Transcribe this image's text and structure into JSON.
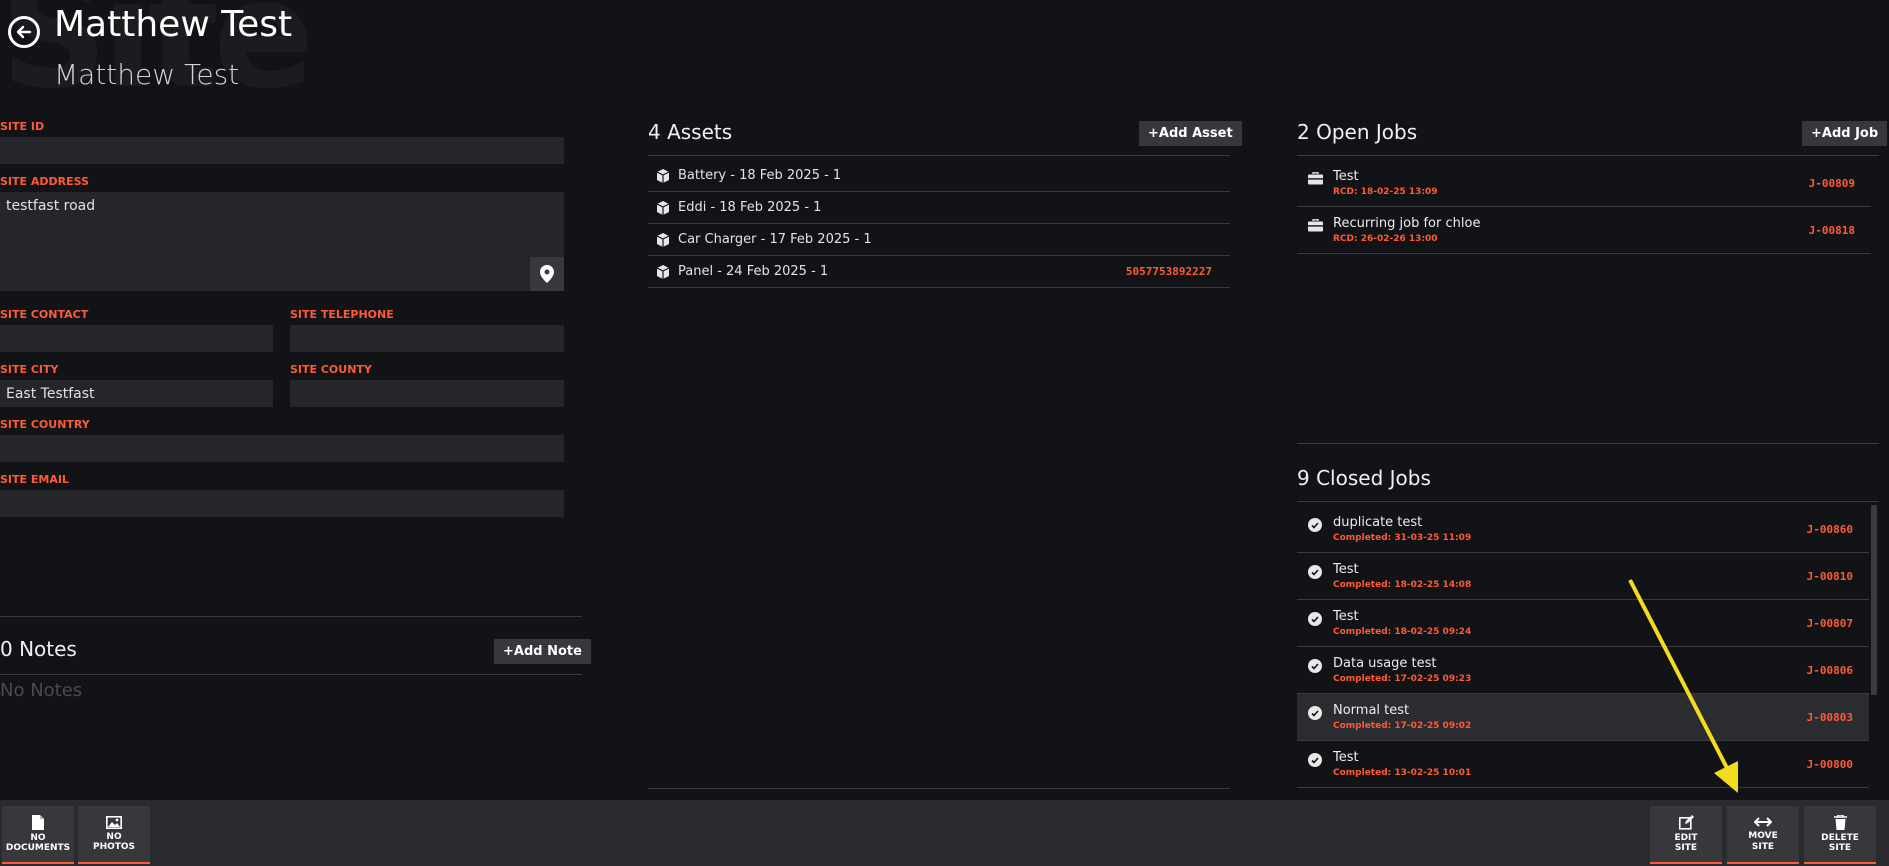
{
  "header": {
    "title": "Matthew Test",
    "subtitle": "Matthew Test",
    "watermark": "Site"
  },
  "form": {
    "site_id": {
      "label": "SITE ID",
      "value": ""
    },
    "site_address": {
      "label": "SITE ADDRESS",
      "value": "testfast road"
    },
    "site_contact": {
      "label": "SITE CONTACT",
      "value": ""
    },
    "site_telephone": {
      "label": "SITE TELEPHONE",
      "value": ""
    },
    "site_city": {
      "label": "SITE CITY",
      "value": "East Testfast"
    },
    "site_county": {
      "label": "SITE COUNTY",
      "value": ""
    },
    "site_country": {
      "label": "SITE COUNTRY",
      "value": ""
    },
    "site_email": {
      "label": "SITE EMAIL",
      "value": ""
    }
  },
  "notes": {
    "title": "0 Notes",
    "add_label": "+Add Note",
    "empty_text": "No Notes"
  },
  "assets": {
    "title": "4 Assets",
    "add_label": "+Add Asset",
    "items": [
      {
        "name": "Battery - 18 Feb 2025 - 1",
        "serial": ""
      },
      {
        "name": "Eddi - 18 Feb 2025 - 1",
        "serial": ""
      },
      {
        "name": "Car Charger - 17 Feb 2025 - 1",
        "serial": ""
      },
      {
        "name": "Panel - 24 Feb 2025 - 1",
        "serial": "5057753892227"
      }
    ]
  },
  "open_jobs": {
    "title": "2 Open Jobs",
    "add_label": "+Add Job",
    "items": [
      {
        "name": "Test",
        "sub": "RCD: 18-02-25 13:09",
        "id": "J-00809"
      },
      {
        "name": "Recurring job for chloe",
        "sub": "RCD: 26-02-26 13:00",
        "id": "J-00818"
      }
    ]
  },
  "closed_jobs": {
    "title": "9 Closed Jobs",
    "items": [
      {
        "name": "duplicate test",
        "sub": "Completed: 31-03-25 11:09",
        "id": "J-00860"
      },
      {
        "name": "Test",
        "sub": "Completed: 18-02-25 14:08",
        "id": "J-00810"
      },
      {
        "name": "Test",
        "sub": "Completed: 18-02-25 09:24",
        "id": "J-00807"
      },
      {
        "name": "Data usage test",
        "sub": "Completed: 17-02-25 09:23",
        "id": "J-00806"
      },
      {
        "name": "Normal test",
        "sub": "Completed: 17-02-25 09:02",
        "id": "J-00803"
      },
      {
        "name": "Test",
        "sub": "Completed: 13-02-25 10:01",
        "id": "J-00800"
      }
    ]
  },
  "bottombar": {
    "documents": "NO\nDOCUMENTS",
    "photos": "NO\nPHOTOS",
    "edit": "EDIT\nSITE",
    "move": "MOVE\nSITE",
    "delete": "DELETE\nSITE"
  },
  "colors": {
    "accent": "#ff5a36",
    "background": "#121316",
    "input": "#25262a",
    "annotation_arrow": "#f2dc1d"
  }
}
